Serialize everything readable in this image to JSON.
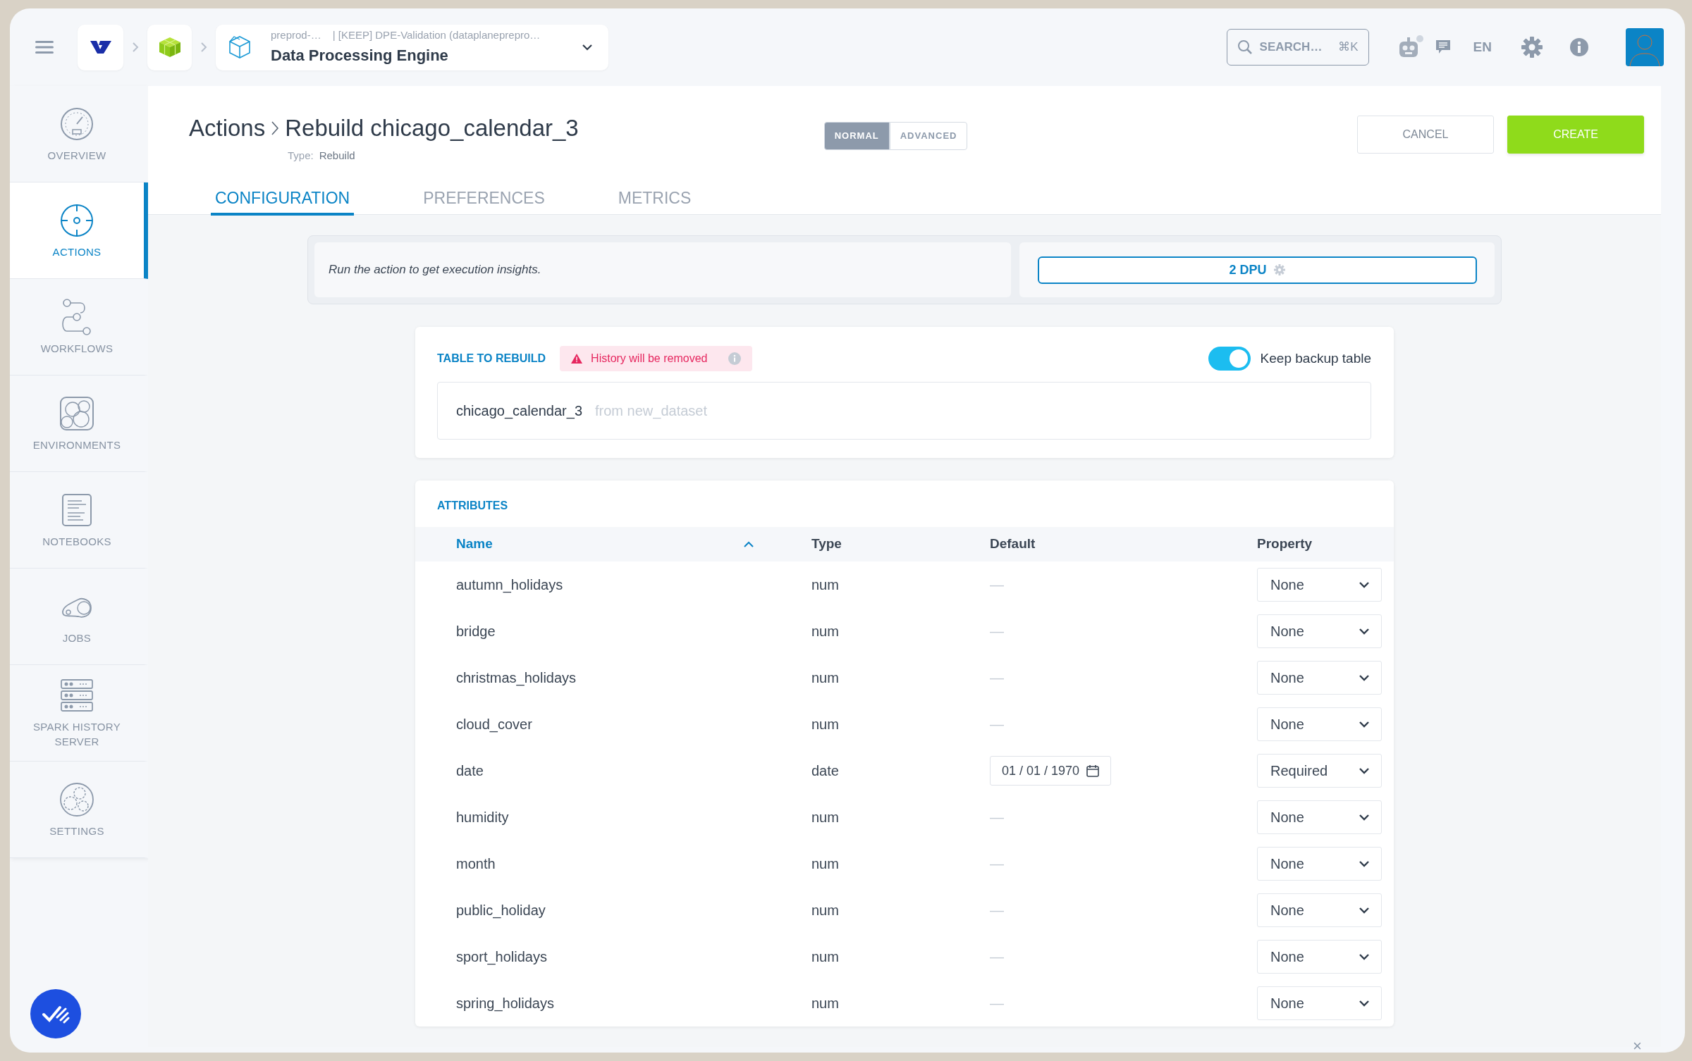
{
  "topbar": {
    "breadcrumb": [
      {
        "kind": "logo"
      },
      {
        "kind": "product"
      },
      {
        "kind": "service",
        "subtitle_left": "preprod-…",
        "subtitle_right": "| [KEEP] DPE-Validation (dataplanepreprо…",
        "title": "Data Processing Engine"
      }
    ],
    "search": {
      "placeholder": "SEARCH…",
      "shortcut": "⌘K"
    },
    "language": "EN"
  },
  "sidebar": {
    "items": [
      {
        "label": "OVERVIEW",
        "selected": false
      },
      {
        "label": "ACTIONS",
        "selected": true
      },
      {
        "label": "WORKFLOWS",
        "selected": false
      },
      {
        "label": "ENVIRONMENTS",
        "selected": false
      },
      {
        "label": "NOTEBOOKS",
        "selected": false
      },
      {
        "label": "JOBS",
        "selected": false
      },
      {
        "label": "SPARK HISTORY SERVER",
        "selected": false
      },
      {
        "label": "SETTINGS",
        "selected": false
      }
    ]
  },
  "header": {
    "parent": "Actions",
    "title": "Rebuild chicago_calendar_3",
    "type_label": "Type:",
    "type_value": "Rebuild",
    "modes": [
      {
        "label": "NORMAL",
        "selected": true
      },
      {
        "label": "ADVANCED",
        "selected": false
      }
    ],
    "buttons": [
      {
        "label": "CANCEL",
        "kind": "secondary"
      },
      {
        "label": "CREATE",
        "kind": "primary"
      }
    ],
    "tabs": [
      {
        "label": "CONFIGURATION",
        "selected": true
      },
      {
        "label": "PREFERENCES",
        "selected": false
      },
      {
        "label": "METRICS",
        "selected": false
      }
    ]
  },
  "insights": {
    "message": "Run the action to get execution insights.",
    "dpu": "2 DPU"
  },
  "table_to_rebuild": {
    "heading": "TABLE TO REBUILD",
    "warning": "History will be removed",
    "keep_backup": {
      "label": "Keep backup table",
      "on": true
    },
    "table_name": "chicago_calendar_3",
    "source": "from new_dataset"
  },
  "attributes": {
    "heading": "ATTRIBUTES",
    "columns": [
      {
        "label": "Name",
        "sorted": true
      },
      {
        "label": "Type",
        "sorted": false
      },
      {
        "label": "Default",
        "sorted": false
      },
      {
        "label": "Property",
        "sorted": false
      }
    ],
    "rows": [
      {
        "name": "autumn_holidays",
        "type": "num",
        "kind": "empty",
        "default": "—",
        "property": "None"
      },
      {
        "name": "bridge",
        "type": "num",
        "kind": "empty",
        "default": "—",
        "property": "None"
      },
      {
        "name": "christmas_holidays",
        "type": "num",
        "kind": "empty",
        "default": "—",
        "property": "None"
      },
      {
        "name": "cloud_cover",
        "type": "num",
        "kind": "empty",
        "default": "—",
        "property": "None"
      },
      {
        "name": "date",
        "type": "date",
        "kind": "date",
        "default": "01 / 01 / 1970",
        "property": "Required"
      },
      {
        "name": "humidity",
        "type": "num",
        "kind": "empty",
        "default": "—",
        "property": "None"
      },
      {
        "name": "month",
        "type": "num",
        "kind": "empty",
        "default": "—",
        "property": "None"
      },
      {
        "name": "public_holiday",
        "type": "num",
        "kind": "empty",
        "default": "—",
        "property": "None"
      },
      {
        "name": "sport_holidays",
        "type": "num",
        "kind": "empty",
        "default": "—",
        "property": "None"
      },
      {
        "name": "spring_holidays",
        "type": "num",
        "kind": "empty",
        "default": "—",
        "property": "None"
      }
    ]
  },
  "dismiss": "×"
}
